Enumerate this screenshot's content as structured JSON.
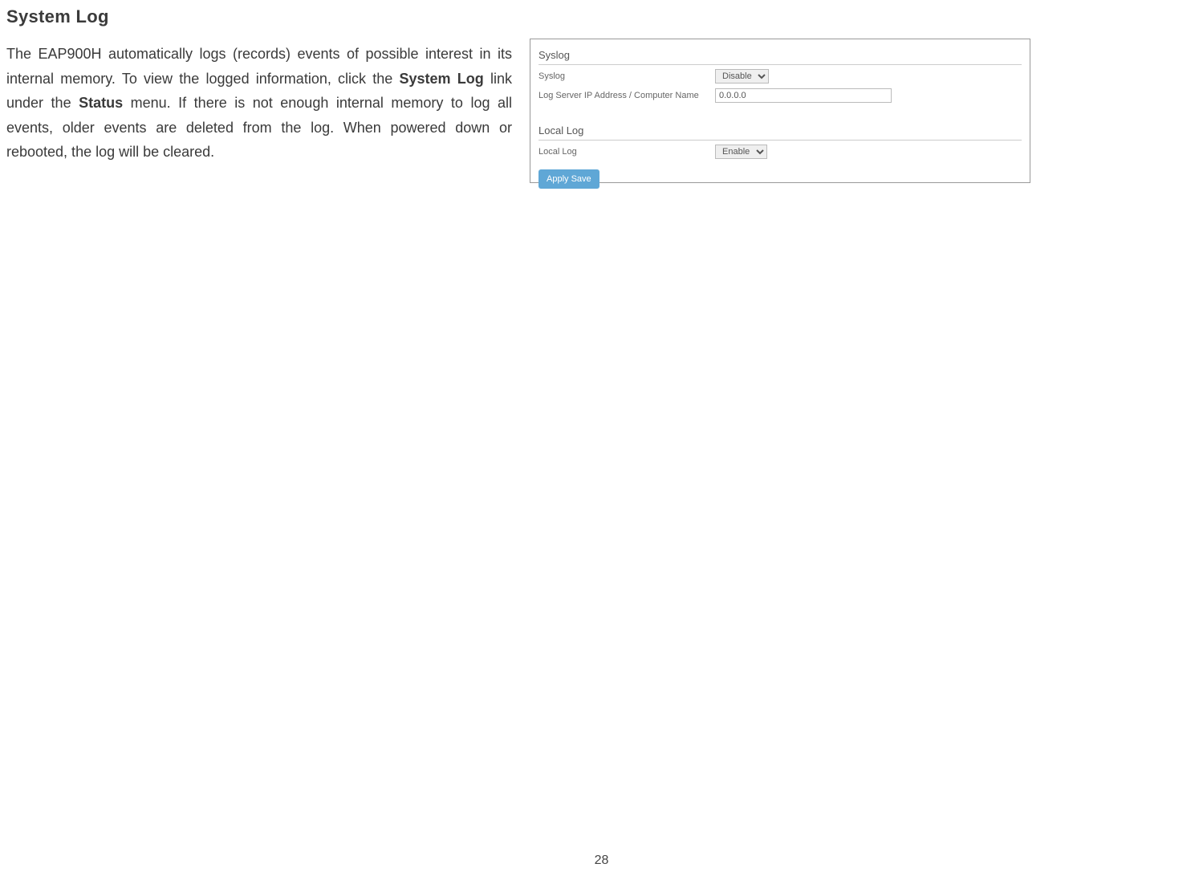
{
  "title": "System Log",
  "paragraph": {
    "part1": "The EAP900H automatically logs (records) events of possible interest in its internal memory. To view the logged information, click the ",
    "bold1": "System Log",
    "part2": " link under the ",
    "bold2": "Status",
    "part3": " menu. If there is not enough internal memory to log all events, older events are deleted from the log. When powered down or rebooted, the log will be cleared."
  },
  "screenshot": {
    "syslog_section": "Syslog",
    "syslog_label": "Syslog",
    "syslog_value": "Disable",
    "ip_label": "Log Server IP Address / Computer Name",
    "ip_value": "0.0.0.0",
    "locallog_section": "Local Log",
    "locallog_label": "Local Log",
    "locallog_value": "Enable",
    "apply_button": "Apply Save"
  },
  "page_number": "28"
}
